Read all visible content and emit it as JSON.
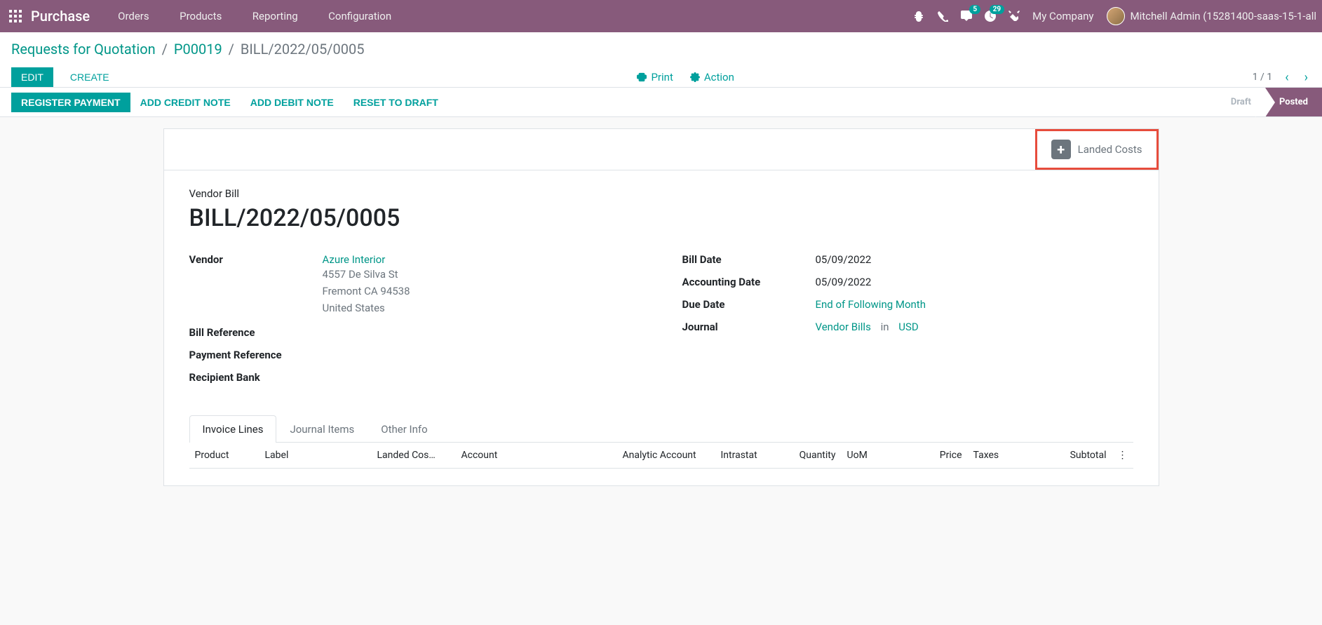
{
  "topnav": {
    "brand": "Purchase",
    "menu": [
      "Orders",
      "Products",
      "Reporting",
      "Configuration"
    ],
    "msg_badge": "5",
    "activity_badge": "29",
    "company": "My Company",
    "user": "Mitchell Admin (15281400-saas-15-1-all"
  },
  "breadcrumb": {
    "root": "Requests for Quotation",
    "mid": "P00019",
    "active": "BILL/2022/05/0005"
  },
  "cp": {
    "edit": "Edit",
    "create": "Create",
    "print": "Print",
    "action": "Action",
    "pager": "1 / 1"
  },
  "statusbar": {
    "register": "Register Payment",
    "credit": "Add Credit Note",
    "debit": "Add Debit Note",
    "reset": "Reset to Draft",
    "draft": "Draft",
    "posted": "Posted"
  },
  "stat": {
    "landed": "Landed Costs"
  },
  "form": {
    "title_label": "Vendor Bill",
    "title": "BILL/2022/05/0005",
    "labels": {
      "vendor": "Vendor",
      "bill_ref": "Bill Reference",
      "pay_ref": "Payment Reference",
      "bank": "Recipient Bank",
      "bill_date": "Bill Date",
      "acc_date": "Accounting Date",
      "due_date": "Due Date",
      "journal": "Journal"
    },
    "vendor": {
      "name": "Azure Interior",
      "street": "4557 De Silva St",
      "city": "Fremont CA 94538",
      "country": "United States"
    },
    "bill_date": "05/09/2022",
    "acc_date": "05/09/2022",
    "due_date": "End of Following Month",
    "journal": "Vendor Bills",
    "journal_in": "in",
    "currency": "USD"
  },
  "tabs": {
    "invoice_lines": "Invoice Lines",
    "journal_items": "Journal Items",
    "other_info": "Other Info"
  },
  "columns": {
    "product": "Product",
    "label": "Label",
    "landed": "Landed Cos…",
    "account": "Account",
    "analytic": "Analytic Account",
    "intrastat": "Intrastat",
    "qty": "Quantity",
    "uom": "UoM",
    "price": "Price",
    "taxes": "Taxes",
    "subtotal": "Subtotal",
    "opt": "⋮"
  }
}
